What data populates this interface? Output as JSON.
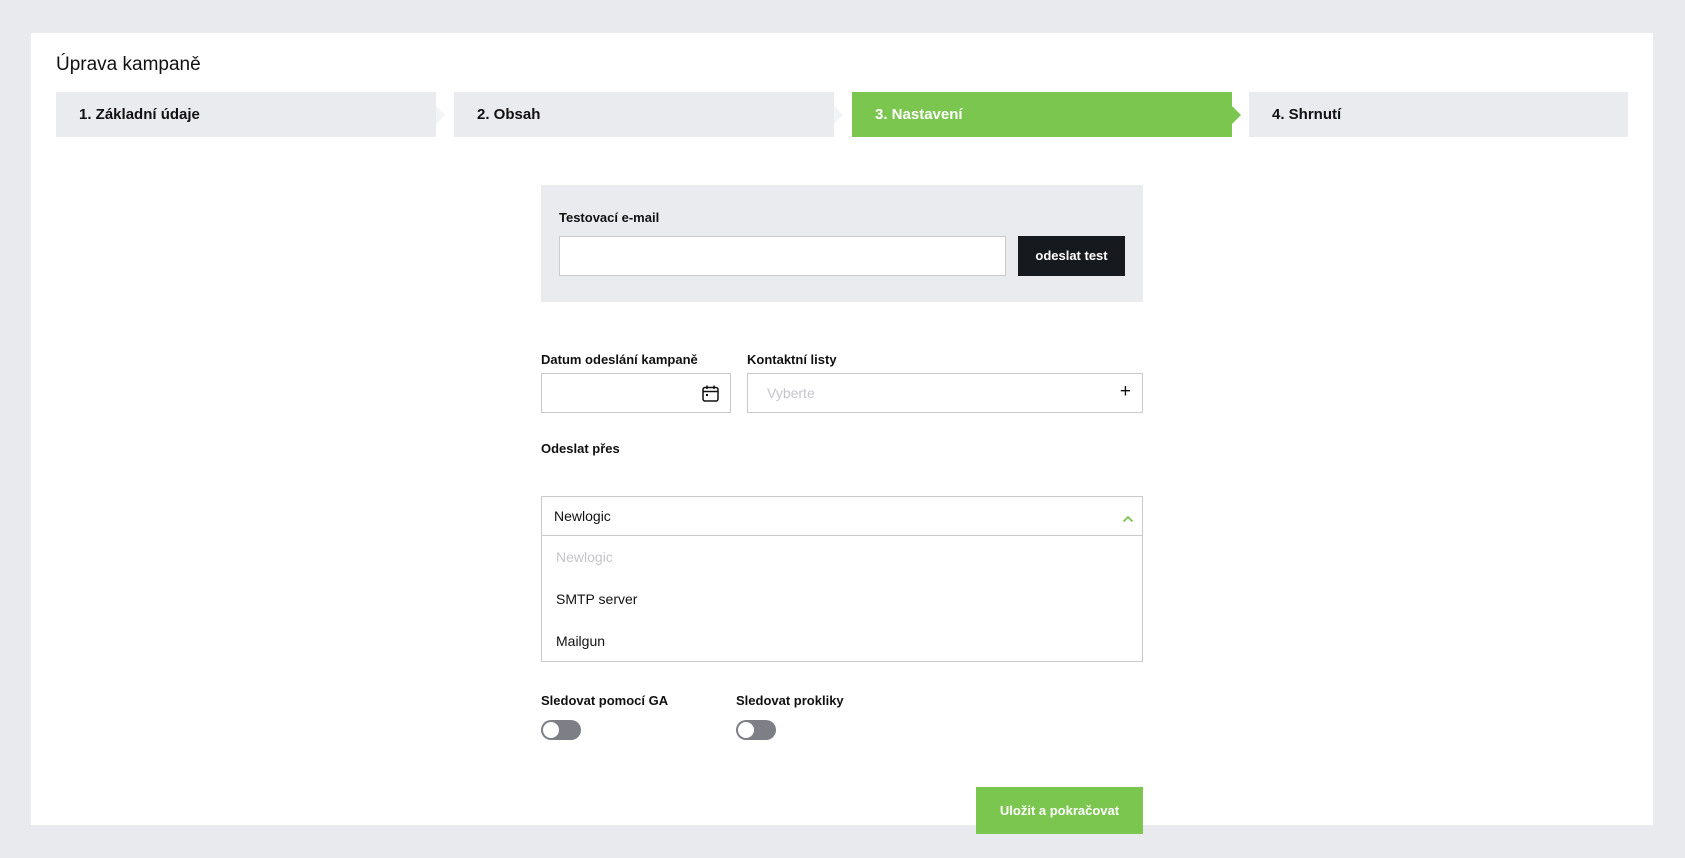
{
  "page": {
    "title": "Úprava kampaně"
  },
  "steps": [
    {
      "label": "1. Základní údaje",
      "active": false
    },
    {
      "label": "2. Obsah",
      "active": false
    },
    {
      "label": "3. Nastavení",
      "active": true
    },
    {
      "label": "4. Shrnutí",
      "active": false
    }
  ],
  "test_email": {
    "label": "Testovací e-mail",
    "value": "",
    "button_label": "odeslat test"
  },
  "send_date": {
    "label": "Datum odeslání kampaně",
    "value": "",
    "icon": "calendar-icon"
  },
  "contact_lists": {
    "label": "Kontaktní listy",
    "placeholder": "Vyberte",
    "icon": "plus-icon",
    "add_symbol": "+"
  },
  "send_via": {
    "label": "Odeslat přes",
    "selected": "Newlogic",
    "icon": "chevron-up-icon",
    "options": [
      "Newlogic",
      "SMTP server",
      "Mailgun"
    ]
  },
  "tracking": {
    "ga_label": "Sledovat pomocí GA",
    "ga_enabled": false,
    "clicks_label": "Sledovat prokliky",
    "clicks_enabled": false
  },
  "save_button_label": "Uložit a pokračovat",
  "colors": {
    "accent": "#7bc64e",
    "dark_button": "#16191d",
    "background": "#e9eaee",
    "step_inactive": "#eaebef",
    "toggle_off": "#7e7f86"
  }
}
